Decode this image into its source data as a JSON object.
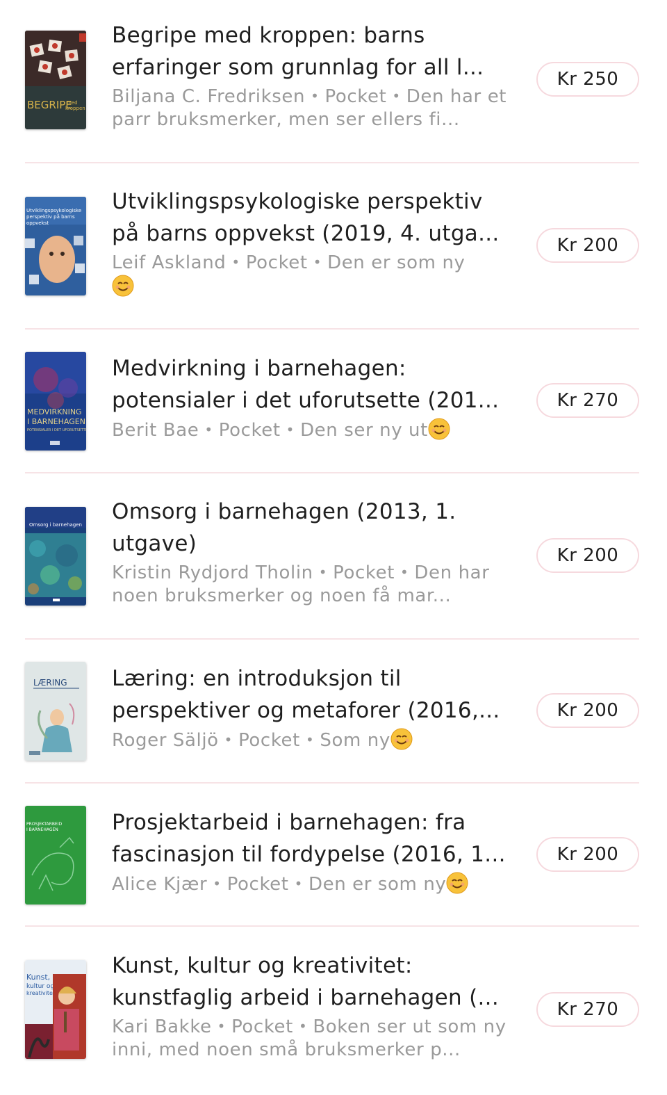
{
  "listings": [
    {
      "title": "Begripe med kroppen: barns erfaringer som grunnlag for all l...",
      "author": "Biljana C. Fredriksen",
      "format": "Pocket",
      "condition": "Den har et parr bruksmerker, men ser ellers fi...",
      "price": "Kr 250",
      "emoji": false,
      "cover_text": "BEGRIPE"
    },
    {
      "title": "Utviklingspsykologiske perspektiv på barns oppvekst (2019, 4. utga...",
      "author": "Leif Askland",
      "format": "Pocket",
      "condition": "Den er som ny",
      "price": "Kr 200",
      "emoji": true,
      "cover_text": "Utviklingspsykologiske perspektiv på barns oppvekst"
    },
    {
      "title": "Medvirkning i barnehagen: potensialer i det uforutsette (201...",
      "author": "Berit Bae",
      "format": "Pocket",
      "condition": "Den ser ny ut",
      "price": "Kr 270",
      "emoji": true,
      "cover_text": "MEDVIRKNING I BARNEHAGEN"
    },
    {
      "title": "Omsorg i barnehagen (2013, 1. utgave)",
      "author": "Kristin Rydjord Tholin",
      "format": "Pocket",
      "condition": "Den har noen bruksmerker og noen få mar...",
      "price": "Kr 200",
      "emoji": false,
      "cover_text": "Omsorg i barnehagen"
    },
    {
      "title": "Læring: en introduksjon til perspektiver og metaforer (2016,...",
      "author": "Roger Säljö",
      "format": "Pocket",
      "condition": "Som ny",
      "price": "Kr 200",
      "emoji": true,
      "cover_text": "LÆRING"
    },
    {
      "title": "Prosjektarbeid i barnehagen: fra fascinasjon til fordypelse (2016, 1...",
      "author": "Alice Kjær",
      "format": "Pocket",
      "condition": "Den er som ny",
      "price": "Kr 200",
      "emoji": true,
      "cover_text": "PROSJEKTARBEID I BARNEHAGEN"
    },
    {
      "title": "Kunst, kultur og kreativitet: kunstfaglig arbeid i barnehagen (...",
      "author": "Kari Bakke",
      "format": "Pocket",
      "condition": "Boken ser ut som ny inni, med noen små bruksmerker p...",
      "price": "Kr 270",
      "emoji": false,
      "cover_text": "Kunst, kultur og kreativitet"
    }
  ],
  "separator": "•",
  "colors": {
    "price_border": "#f6d9de",
    "divider": "#f7e3e6",
    "meta_text": "#9a9a9a"
  }
}
